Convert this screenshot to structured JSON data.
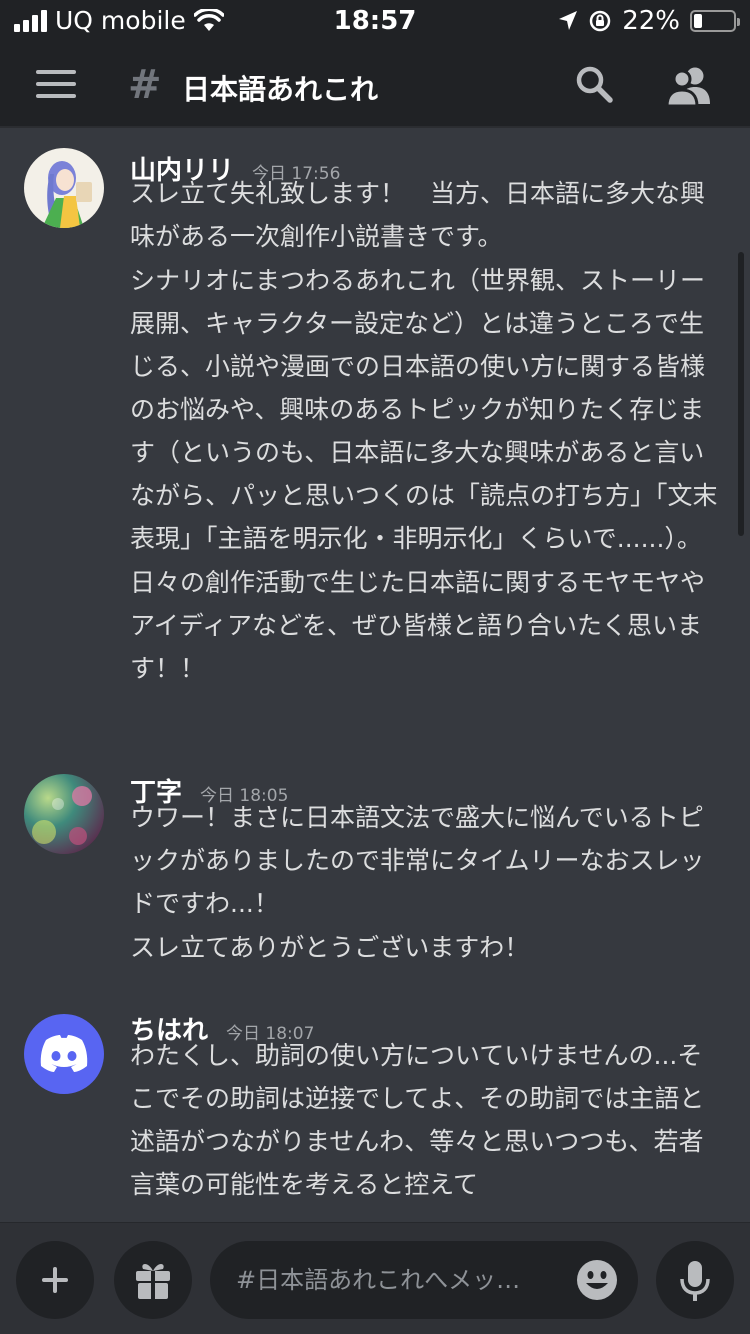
{
  "status_bar": {
    "carrier": "UQ mobile",
    "time": "18:57",
    "battery_percent": "22%",
    "battery_level": 0.22,
    "icons": [
      "signal-icon",
      "wifi-icon",
      "location-icon",
      "orientation-lock-icon",
      "battery-icon"
    ]
  },
  "header": {
    "channel_name": "日本語あれこれ",
    "icons": [
      "menu-icon",
      "channel-hash-icon",
      "search-icon",
      "members-icon"
    ]
  },
  "messages": [
    {
      "author": "山内リリ",
      "timestamp": "今日 17:56",
      "paragraphs": [
        "スレ立て失礼致します！　当方、日本語に多大な興味がある一次創作小説書きです。",
        "シナリオにまつわるあれこれ（世界観、ストーリー展開、キャラクター設定など）とは違うところで生じる、小説や漫画での日本語の使い方に関する皆様のお悩みや、興味のあるトピックが知りたく存じます（というのも、日本語に多大な興味があると言いながら、パッと思いつくのは「読点の打ち方」「文末表現」「主語を明示化・非明示化」くらいで......）。",
        "日々の創作活動で生じた日本語に関するモヤモヤやアイディアなどを、ぜひ皆様と語り合いたく思います！！"
      ]
    },
    {
      "author": "丁字",
      "timestamp": "今日 18:05",
      "paragraphs": [
        "ウワー！まさに日本語文法で盛大に悩んでいるトピックがありましたので非常にタイムリーなおスレッドですわ...！",
        "スレ立てありがとうございますわ！"
      ]
    },
    {
      "author": "ちはれ",
      "timestamp": "今日 18:07",
      "paragraphs": [
        "わたくし、助詞の使い方についていけませんの...そこでその助詞は逆接でしてよ、その助詞では主語と述語がつながりませんわ、等々と思いつつも、若者言葉の可能性を考えると控えて"
      ]
    }
  ],
  "composer": {
    "placeholder": "#日本語あれこれへメッ…",
    "value": ""
  },
  "colors": {
    "background": "#36393f",
    "header": "#202225",
    "discord_blurple": "#5865f2"
  }
}
